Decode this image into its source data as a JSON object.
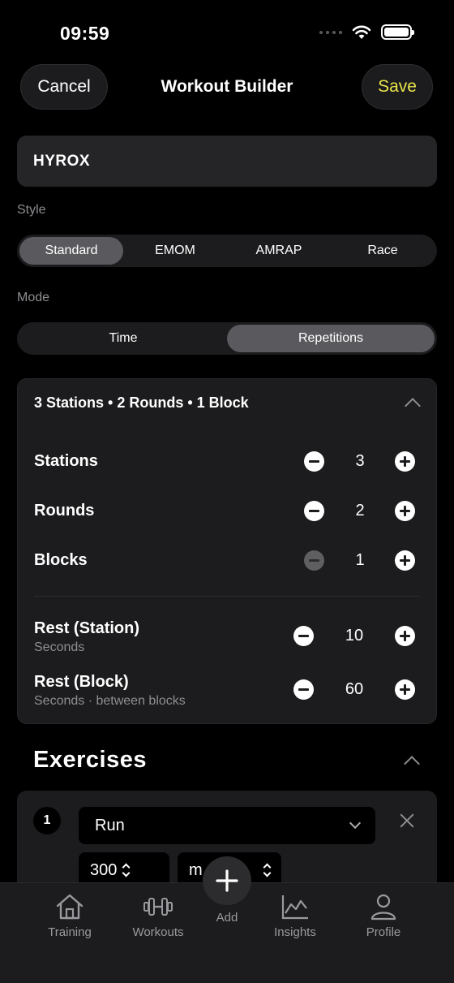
{
  "status_bar": {
    "time": "09:59"
  },
  "nav": {
    "cancel_label": "Cancel",
    "title": "Workout Builder",
    "save_label": "Save"
  },
  "workout_name": "HYROX",
  "style": {
    "label": "Style",
    "options": [
      "Standard",
      "EMOM",
      "AMRAP",
      "Race"
    ],
    "selected": "Standard"
  },
  "mode": {
    "label": "Mode",
    "options": [
      "Time",
      "Repetitions"
    ],
    "selected": "Repetitions"
  },
  "config": {
    "summary": "3 Stations • 2 Rounds • 1 Block",
    "stations": {
      "label": "Stations",
      "value": "3"
    },
    "rounds": {
      "label": "Rounds",
      "value": "2"
    },
    "blocks": {
      "label": "Blocks",
      "value": "1"
    },
    "rest_station": {
      "label": "Rest (Station)",
      "sub": "Seconds",
      "value": "10"
    },
    "rest_block": {
      "label": "Rest (Block)",
      "sub": "Seconds · between blocks",
      "value": "60"
    }
  },
  "exercises": {
    "title": "Exercises",
    "items": [
      {
        "number": "1",
        "name": "Run",
        "amount": "300",
        "unit": "m"
      }
    ]
  },
  "tab_bar": {
    "training": "Training",
    "workouts": "Workouts",
    "add": "Add",
    "insights": "Insights",
    "profile": "Profile"
  },
  "colors": {
    "accent": "#e8e34a",
    "card": "#1c1c1e",
    "active_segment": "#5a5a5e"
  }
}
